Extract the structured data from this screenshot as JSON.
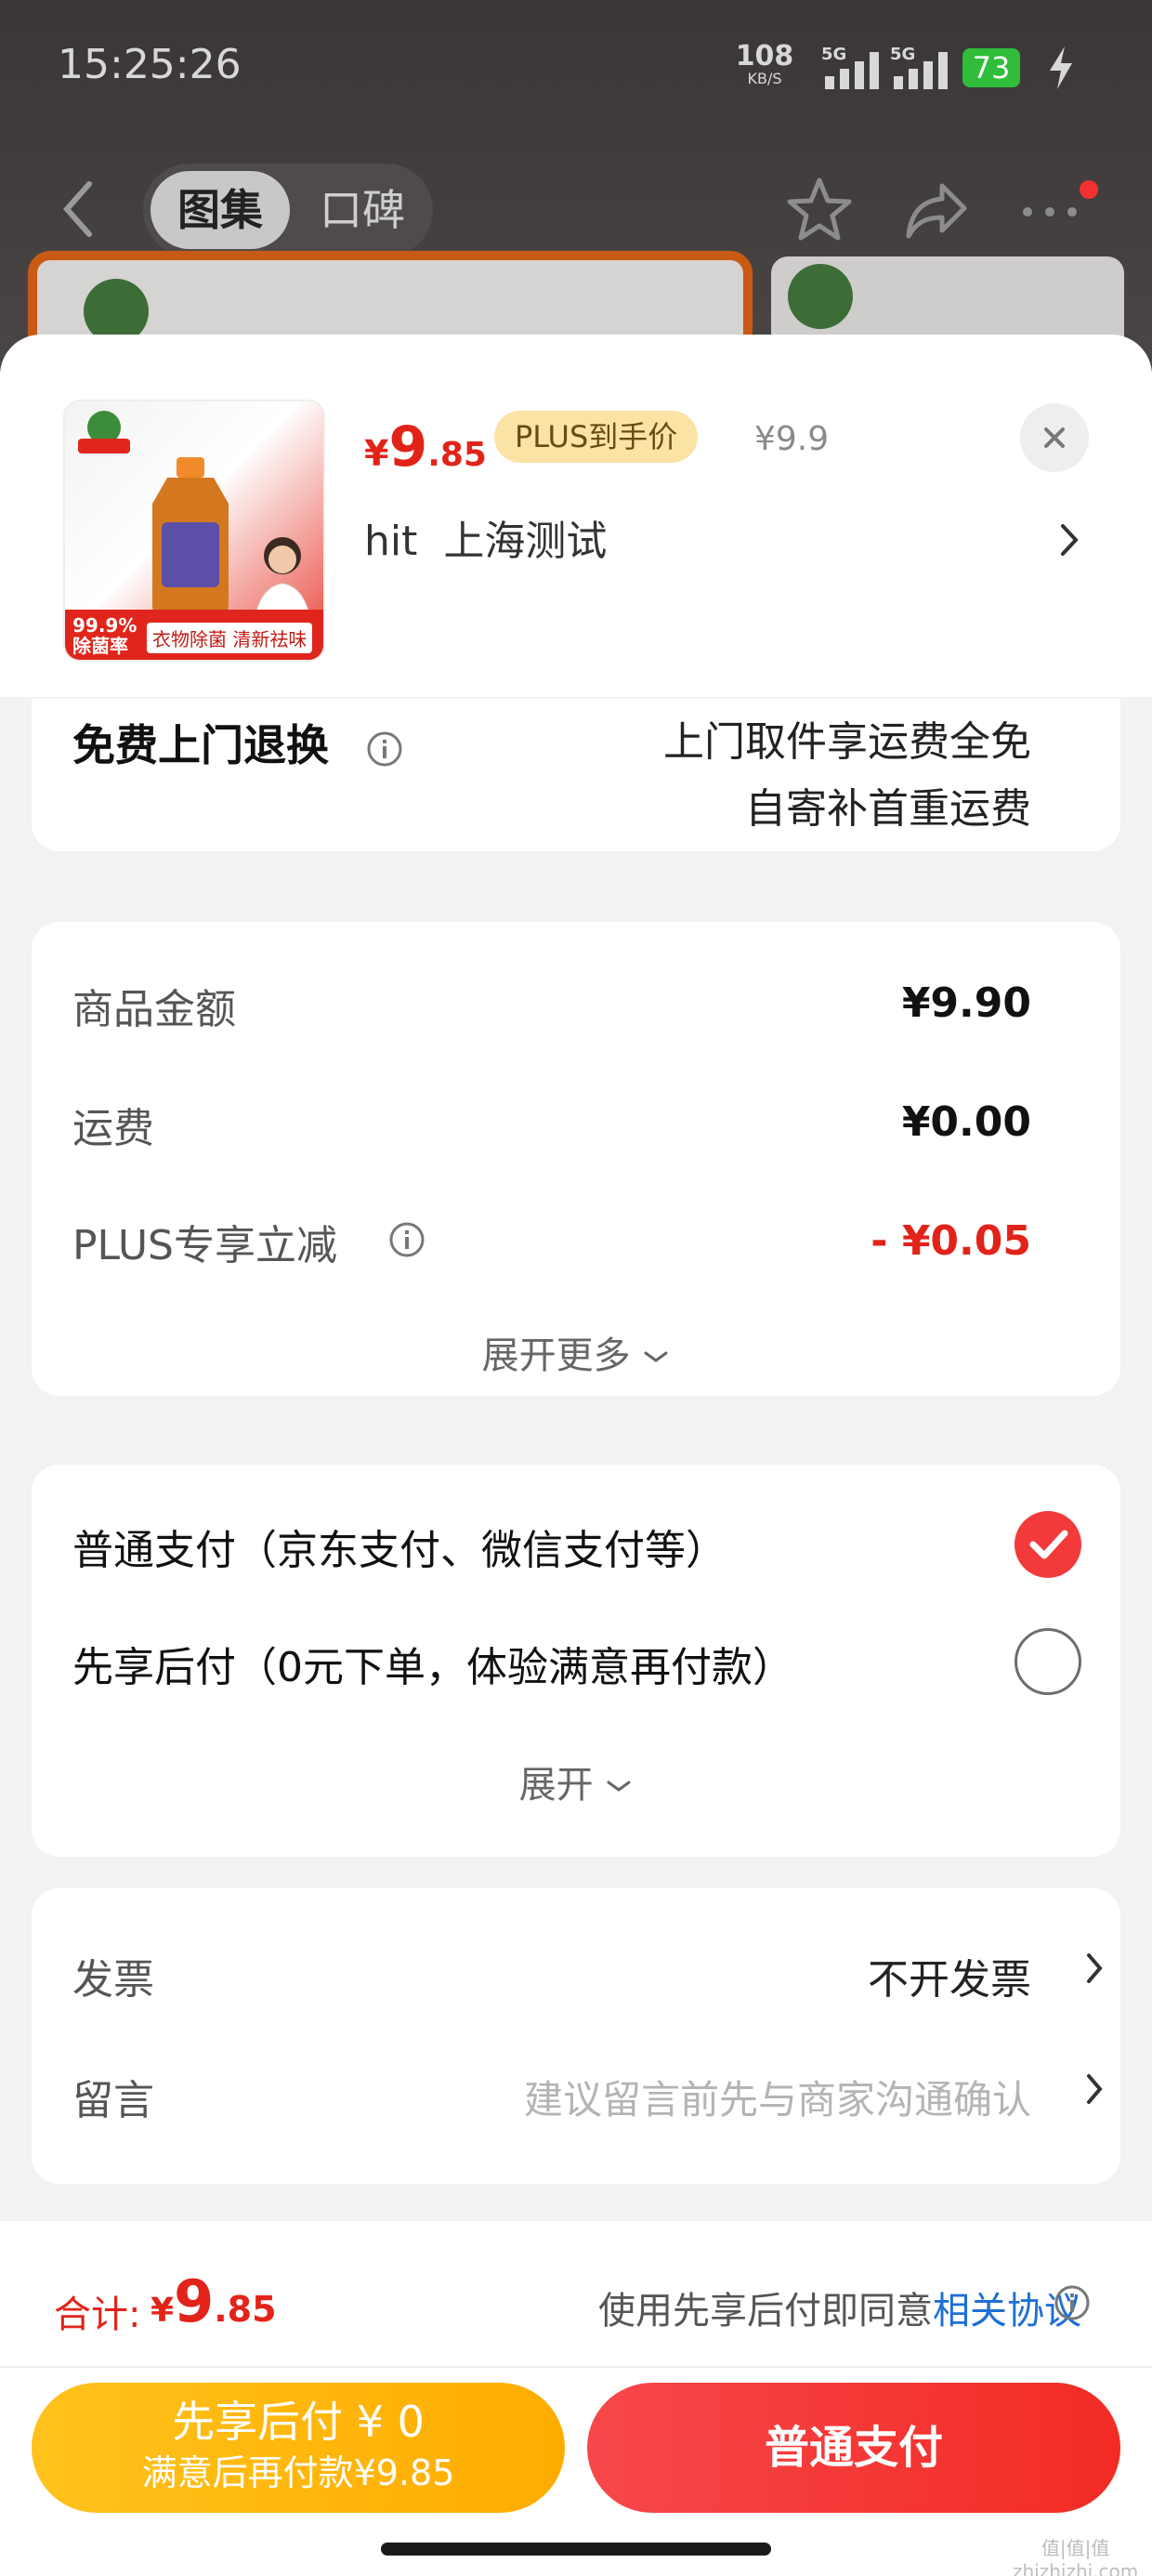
{
  "status_bar": {
    "time": "15:25:26",
    "net_speed_value": "108",
    "net_speed_unit": "KB/S",
    "signal1_label": "5G",
    "signal2_label": "5G",
    "battery": "73"
  },
  "background_nav": {
    "tabs": [
      "图集",
      "口碑"
    ],
    "active_tab": "图集"
  },
  "product": {
    "image_tag_percent": "99.9%\n除菌率",
    "image_tag_text": "衣物除菌 清新祛味",
    "price_symbol": "¥",
    "price_int": "9",
    "price_dec": ".85",
    "plus_badge": "PLUS到手价",
    "original_price": "¥9.9",
    "address": "hit  上海测试"
  },
  "return_service": {
    "title": "免费上门退换",
    "line1": "上门取件享运费全免",
    "line2": "自寄补首重运费"
  },
  "price_detail": {
    "rows": [
      {
        "label": "商品金额",
        "value": "¥9.90"
      },
      {
        "label": "运费",
        "value": "¥0.00"
      },
      {
        "label": "PLUS专享立减",
        "value": "- ¥0.05"
      }
    ],
    "expand_more": "展开更多",
    "discount_color": "#e2231a"
  },
  "payment": {
    "options": [
      {
        "label": "普通支付（京东支付、微信支付等）",
        "checked": true
      },
      {
        "label": "先享后付（0元下单，体验满意再付款）",
        "checked": false
      }
    ],
    "expand": "展开"
  },
  "extra": {
    "invoice_label": "发票",
    "invoice_value": "不开发票",
    "note_label": "留言",
    "note_placeholder": "建议留言前先与商家沟通确认"
  },
  "footer": {
    "total_label": "合计:",
    "total_symbol": "¥",
    "total_int": "9",
    "total_dec": ".85",
    "agree_text": "使用先享后付即同意",
    "agree_link": "相关协议",
    "btn_later_line1": "先享后付 ¥ 0",
    "btn_later_line2": "满意后再付款¥9.85",
    "btn_normal": "普通支付",
    "watermark": "值|值|值\nzhizhizhi.com"
  },
  "colors": {
    "accent_red": "#e2231a",
    "plus_gold": "#fbe3a6",
    "pay_later_yellow": "#ffb400",
    "link_blue": "#1f6fd6"
  }
}
